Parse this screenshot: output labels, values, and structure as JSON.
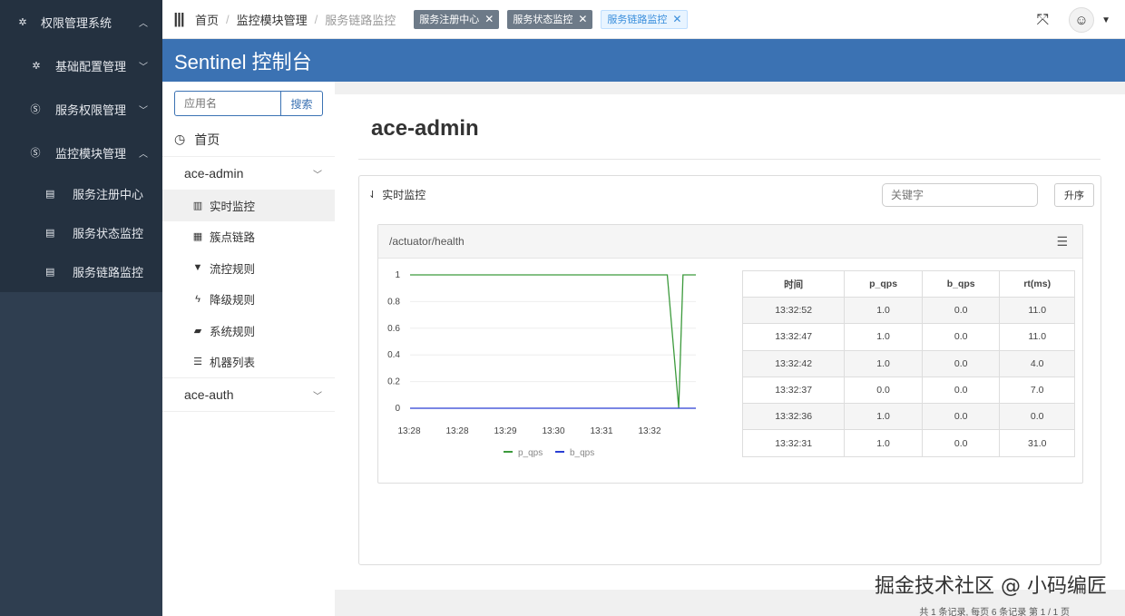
{
  "left_nav": {
    "sections": [
      {
        "label": "权限管理系统",
        "icon": "gear-icon",
        "chevron": "^"
      },
      {
        "label": "基础配置管理",
        "icon": "gear-icon",
        "chevron": "⌄"
      },
      {
        "label": "服务权限管理",
        "icon": "s-circle-icon",
        "chevron": "⌄"
      },
      {
        "label": "监控模块管理",
        "icon": "s-circle-icon",
        "chevron": "^"
      }
    ],
    "sub_items": [
      "服务注册中心",
      "服务状态监控",
      "服务链路监控"
    ]
  },
  "topbar": {
    "breadcrumb": [
      "首页",
      "监控模块管理",
      "服务链路监控"
    ],
    "tags": [
      {
        "label": "服务注册中心",
        "active": false
      },
      {
        "label": "服务状态监控",
        "active": false
      },
      {
        "label": "服务链路监控",
        "active": true
      }
    ]
  },
  "sentinel": {
    "title": "Sentinel 控制台"
  },
  "app_sidebar": {
    "search_placeholder": "应用名",
    "search_button": "搜索",
    "home": "首页",
    "app1": "ace-admin",
    "menu": [
      "实时监控",
      "簇点链路",
      "流控规则",
      "降级规则",
      "系统规则",
      "机器列表"
    ],
    "app2": "ace-auth"
  },
  "content": {
    "title": "ace-admin",
    "panel_title": "实时监控",
    "keyword_placeholder": "关键字",
    "sort_button": "升序",
    "resource": "/actuator/health",
    "pager": "共 1 条记录, 每页 6 条记录 第 1 / 1 页"
  },
  "table": {
    "headers": [
      "时间",
      "p_qps",
      "b_qps",
      "rt(ms)"
    ],
    "rows": [
      [
        "13:32:52",
        "1.0",
        "0.0",
        "11.0"
      ],
      [
        "13:32:47",
        "1.0",
        "0.0",
        "11.0"
      ],
      [
        "13:32:42",
        "1.0",
        "0.0",
        "4.0"
      ],
      [
        "13:32:37",
        "0.0",
        "0.0",
        "7.0"
      ],
      [
        "13:32:36",
        "1.0",
        "0.0",
        "0.0"
      ],
      [
        "13:32:31",
        "1.0",
        "0.0",
        "31.0"
      ]
    ]
  },
  "colors": {
    "nav_bg": "#2f3e50",
    "brand_blue": "#3b72b3",
    "p_qps": "#3c9a3c",
    "b_qps": "#2a3fd4"
  },
  "chart_data": {
    "type": "line",
    "x": [
      "13:28",
      "13:28",
      "13:29",
      "13:30",
      "13:31",
      "13:32"
    ],
    "yticks": [
      "1",
      "0.8",
      "0.6",
      "0.4",
      "0.2",
      "0"
    ],
    "ylim": [
      0,
      1
    ],
    "series": [
      {
        "name": "p_qps",
        "points": [
          [
            0,
            1
          ],
          [
            0.9,
            1
          ],
          [
            0.94,
            0
          ],
          [
            0.955,
            1
          ],
          [
            1,
            1
          ]
        ]
      },
      {
        "name": "b_qps",
        "points": [
          [
            0,
            0
          ],
          [
            1,
            0
          ]
        ]
      }
    ],
    "legend": [
      "p_qps",
      "b_qps"
    ],
    "watermark": "掘金技术社区 @ 小码编匠"
  }
}
